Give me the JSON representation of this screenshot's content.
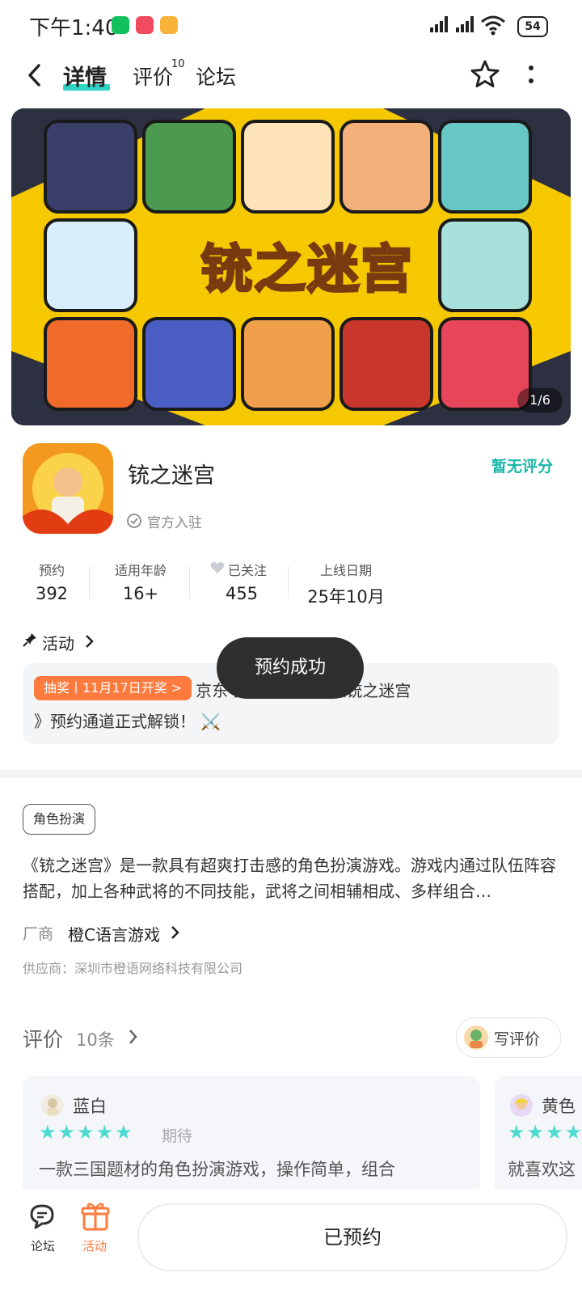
{
  "status_bar": {
    "time": "下午1:40",
    "battery": "54"
  },
  "nav": {
    "tabs": [
      "详情",
      "评价",
      "论坛"
    ],
    "review_badge": "10"
  },
  "banner": {
    "title": "铳之迷宫",
    "page_indicator": "1/6"
  },
  "app": {
    "name": "铳之迷宫",
    "rating": "暂无评分",
    "official": "官方入驻"
  },
  "stats": [
    {
      "label": "预约",
      "value": "392"
    },
    {
      "label": "适用年龄",
      "value": "16+"
    },
    {
      "label": "已关注",
      "value": "455"
    },
    {
      "label": "上线日期",
      "value": "25年10月"
    }
  ],
  "activity": {
    "section_title": "活动",
    "tag": "抽奖丨11月17日开奖 >",
    "text_line1": "京东 打击感来袭！《铳之迷宫",
    "text_line2": "》预约通道正式解锁！ ⚔️"
  },
  "toast": "预约成功",
  "genre_tag": "角色扮演",
  "description": "《铳之迷宫》是一款具有超爽打击感的角色扮演游戏。游戏内通过队伍阵容搭配，加上各种武将的不同技能，武将之间相辅相成、多样组合…",
  "vendor": {
    "label": "厂商",
    "name": "橙C语言游戏"
  },
  "supplier": "供应商：深圳市橙语网络科技有限公司",
  "reviews": {
    "title": "评价",
    "count": "10条",
    "write_label": "写评价",
    "items": [
      {
        "user": "蓝白",
        "stars": 5,
        "tag": "期待",
        "text": "一款三国题材的角色扮演游戏，操作简单，组合"
      },
      {
        "user": "黄色",
        "stars": 5,
        "tag": "",
        "text": "就喜欢这"
      }
    ]
  },
  "bottom": {
    "forum_label": "论坛",
    "activity_label": "活动",
    "reserve_button": "已预约"
  },
  "colors": {
    "accent": "#2ed4c4",
    "rating": "#18b8a8",
    "activity_tag": "#ff7a3d",
    "star": "#4fdad0"
  }
}
